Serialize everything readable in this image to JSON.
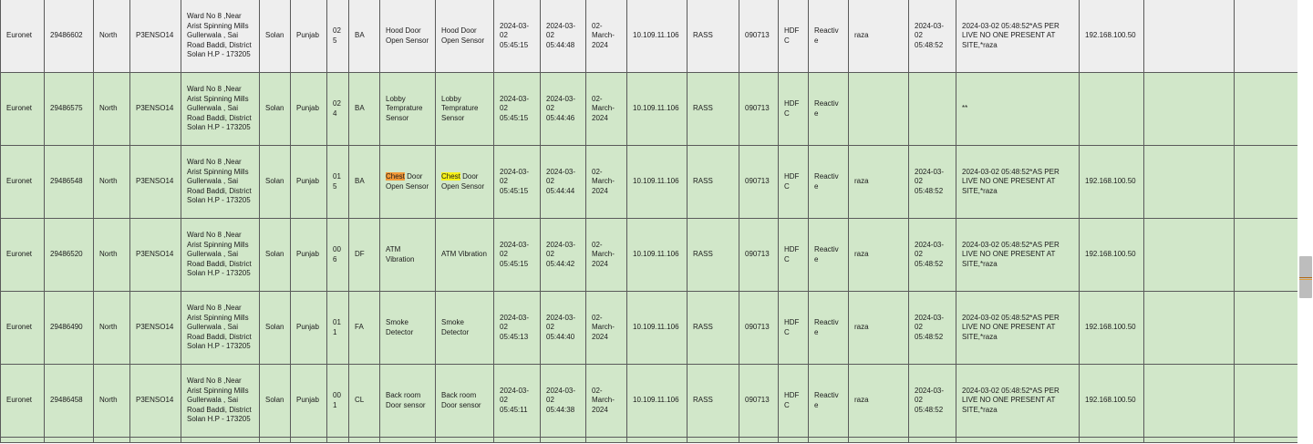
{
  "table": {
    "rows": [
      {
        "bank_network": "Euronet",
        "alarm_id": "29486602",
        "region": "North",
        "site_id": "P3ENSO14",
        "address": "Ward No 8 ,Near Arist Spinning Mills Gullerwala , Sai Road Baddi, District Solan H.P - 173205",
        "city": "Solan",
        "state": "Punjab",
        "zone_code": "025",
        "alarm_code": "BA",
        "alert": "Hood Door Open Sensor",
        "alert_highlight": "",
        "alert_rest": "",
        "alert_2": "Hood Door Open Sensor",
        "alert_2_highlight": "",
        "alert_2_rest": "",
        "created": "2024-03-02 05:45:15",
        "received": "2024-03-02 05:44:48",
        "date": "02-March-2024",
        "panel_ip": "10.109.11.106",
        "panel_type": "RASS",
        "code": "090713",
        "bank": "HDFC",
        "mode": "Reactive",
        "operator": "raza",
        "closed_at": "2024-03-02 05:48:52",
        "comment": "2024-03-02 05:48:52*AS PER LIVE NO ONE PRESENT AT SITE,*raza",
        "router_ip": "192.168.100.50",
        "extra_1": "",
        "extra_2": "",
        "tone": "gray"
      },
      {
        "bank_network": "Euronet",
        "alarm_id": "29486575",
        "region": "North",
        "site_id": "P3ENSO14",
        "address": "Ward No 8 ,Near Arist Spinning Mills Gullerwala , Sai Road Baddi, District Solan H.P - 173205",
        "city": "Solan",
        "state": "Punjab",
        "zone_code": "024",
        "alarm_code": "BA",
        "alert": "Lobby Temprature Sensor",
        "alert_highlight": "",
        "alert_rest": "",
        "alert_2": "Lobby Temprature Sensor",
        "alert_2_highlight": "",
        "alert_2_rest": "",
        "created": "2024-03-02 05:45:15",
        "received": "2024-03-02 05:44:46",
        "date": "02-March-2024",
        "panel_ip": "10.109.11.106",
        "panel_type": "RASS",
        "code": "090713",
        "bank": "HDFC",
        "mode": "Reactive",
        "operator": "",
        "closed_at": "",
        "comment": "**",
        "router_ip": "",
        "extra_1": "",
        "extra_2": "",
        "tone": "green"
      },
      {
        "bank_network": "Euronet",
        "alarm_id": "29486548",
        "region": "North",
        "site_id": "P3ENSO14",
        "address": "Ward No 8 ,Near Arist Spinning Mills Gullerwala , Sai Road Baddi, District Solan H.P - 173205",
        "city": "Solan",
        "state": "Punjab",
        "zone_code": "015",
        "alarm_code": "BA",
        "alert": "",
        "alert_highlight": "Chest",
        "alert_rest": " Door Open Sensor",
        "alert_2": "",
        "alert_2_highlight": "Chest",
        "alert_2_rest": " Door Open Sensor",
        "created": "2024-03-02 05:45:15",
        "received": "2024-03-02 05:44:44",
        "date": "02-March-2024",
        "panel_ip": "10.109.11.106",
        "panel_type": "RASS",
        "code": "090713",
        "bank": "HDFC",
        "mode": "Reactive",
        "operator": "raza",
        "closed_at": "2024-03-02 05:48:52",
        "comment": "2024-03-02 05:48:52*AS PER LIVE NO ONE PRESENT AT SITE,*raza",
        "router_ip": "192.168.100.50",
        "extra_1": "",
        "extra_2": "",
        "tone": "green"
      },
      {
        "bank_network": "Euronet",
        "alarm_id": "29486520",
        "region": "North",
        "site_id": "P3ENSO14",
        "address": "Ward No 8 ,Near Arist Spinning Mills Gullerwala , Sai Road Baddi, District Solan H.P - 173205",
        "city": "Solan",
        "state": "Punjab",
        "zone_code": "006",
        "alarm_code": "DF",
        "alert": "ATM Vibration",
        "alert_highlight": "",
        "alert_rest": "",
        "alert_2": "ATM Vibration",
        "alert_2_highlight": "",
        "alert_2_rest": "",
        "created": "2024-03-02 05:45:15",
        "received": "2024-03-02 05:44:42",
        "date": "02-March-2024",
        "panel_ip": "10.109.11.106",
        "panel_type": "RASS",
        "code": "090713",
        "bank": "HDFC",
        "mode": "Reactive",
        "operator": "raza",
        "closed_at": "2024-03-02 05:48:52",
        "comment": "2024-03-02 05:48:52*AS PER LIVE NO ONE PRESENT AT SITE,*raza",
        "router_ip": "192.168.100.50",
        "extra_1": "",
        "extra_2": "",
        "tone": "green"
      },
      {
        "bank_network": "Euronet",
        "alarm_id": "29486490",
        "region": "North",
        "site_id": "P3ENSO14",
        "address": "Ward No 8 ,Near Arist Spinning Mills Gullerwala , Sai Road Baddi, District Solan H.P - 173205",
        "city": "Solan",
        "state": "Punjab",
        "zone_code": "011",
        "alarm_code": "FA",
        "alert": "Smoke Detector",
        "alert_highlight": "",
        "alert_rest": "",
        "alert_2": "Smoke Detector",
        "alert_2_highlight": "",
        "alert_2_rest": "",
        "created": "2024-03-02 05:45:13",
        "received": "2024-03-02 05:44:40",
        "date": "02-March-2024",
        "panel_ip": "10.109.11.106",
        "panel_type": "RASS",
        "code": "090713",
        "bank": "HDFC",
        "mode": "Reactive",
        "operator": "raza",
        "closed_at": "2024-03-02 05:48:52",
        "comment": "2024-03-02 05:48:52*AS PER LIVE NO ONE PRESENT AT SITE,*raza",
        "router_ip": "192.168.100.50",
        "extra_1": "",
        "extra_2": "",
        "tone": "green"
      },
      {
        "bank_network": "Euronet",
        "alarm_id": "29486458",
        "region": "North",
        "site_id": "P3ENSO14",
        "address": "Ward No 8 ,Near Arist Spinning Mills Gullerwala , Sai Road Baddi, District Solan H.P - 173205",
        "city": "Solan",
        "state": "Punjab",
        "zone_code": "001",
        "alarm_code": "CL",
        "alert": "Back room Door sensor",
        "alert_highlight": "",
        "alert_rest": "",
        "alert_2": "Back room Door sensor",
        "alert_2_highlight": "",
        "alert_2_rest": "",
        "created": "2024-03-02 05:45:11",
        "received": "2024-03-02 05:44:38",
        "date": "02-March-2024",
        "panel_ip": "10.109.11.106",
        "panel_type": "RASS",
        "code": "090713",
        "bank": "HDFC",
        "mode": "Reactive",
        "operator": "raza",
        "closed_at": "2024-03-02 05:48:52",
        "comment": "2024-03-02 05:48:52*AS PER LIVE NO ONE PRESENT AT SITE,*raza",
        "router_ip": "192.168.100.50",
        "extra_1": "",
        "extra_2": "",
        "tone": "green"
      }
    ]
  },
  "colors": {
    "row_gray": "#eeeeee",
    "row_green": "#d1e7c9",
    "highlight_orange": "#f39a38",
    "highlight_yellow": "#f7f218",
    "border": "#5a5a5a"
  },
  "icons": {
    "scrollbar": "vertical-scrollbar-thumb"
  }
}
